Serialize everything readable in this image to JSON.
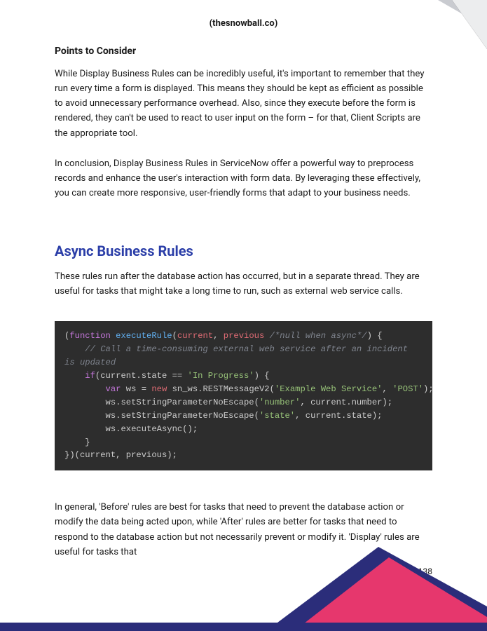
{
  "header": {
    "brand": "(thesnowball.co)"
  },
  "section1": {
    "heading": "Points to Consider",
    "p1": "While Display Business Rules can be incredibly useful, it's important to remember that they run every time a form is displayed. This means they should be kept as efficient as possible to avoid unnecessary performance overhead. Also, since they execute before the form is rendered, they can't be used to react to user input on the form – for that, Client Scripts are the appropriate tool.",
    "p2": "In conclusion, Display Business Rules in ServiceNow offer a powerful way to preprocess records and enhance the user's interaction with form data. By leveraging these effectively, you can create more responsive, user-friendly forms that adapt to your business needs."
  },
  "section2": {
    "heading": "Async Business Rules",
    "intro": "These rules run after the database action has occurred, but in a separate thread. They are useful for tasks that might take a long time to run, such as external web service calls.",
    "after": "In general, 'Before' rules are best for tasks that need to prevent the database action or modify the data being acted upon, while 'After' rules are better for tasks that need to respond to the database action but not necessarily prevent or modify it. 'Display' rules are useful for tasks that"
  },
  "code": {
    "l1_open": "(",
    "l1_function": "function",
    "l1_name": " executeRule",
    "l1_args_open": "(",
    "l1_arg1": "current",
    "l1_comma1": ", ",
    "l1_arg2": "previous",
    "l1_space": " ",
    "l1_comment": "/*null when async*/",
    "l1_args_close": ") {",
    "l2_comment": "    // Call a time-consuming external web service after an incident is updated",
    "l3_if": "    if",
    "l3_cond_open": "(current.state == ",
    "l3_str": "'In Progress'",
    "l3_cond_close": ") {",
    "l4_var": "        var",
    "l4_ws": " ws = ",
    "l4_new": "new",
    "l4_ctor": " sn_ws.RESTMessageV2(",
    "l4_str1": "'Example Web Service'",
    "l4_comma": ", ",
    "l4_str2": "'POST'",
    "l4_close": ");",
    "l5_pre": "        ws.setStringParameterNoEscape(",
    "l5_str": "'number'",
    "l5_post": ", current.number);",
    "l6_pre": "        ws.setStringParameterNoEscape(",
    "l6_str": "'state'",
    "l6_post": ", current.state);",
    "l7": "        ws.executeAsync();",
    "l8": "    }",
    "l9": "})(current, previous);"
  },
  "page_number": "138",
  "colors": {
    "pink": "#e6376d",
    "purple": "#2b2d7a",
    "grey": "#c9cbd0"
  }
}
